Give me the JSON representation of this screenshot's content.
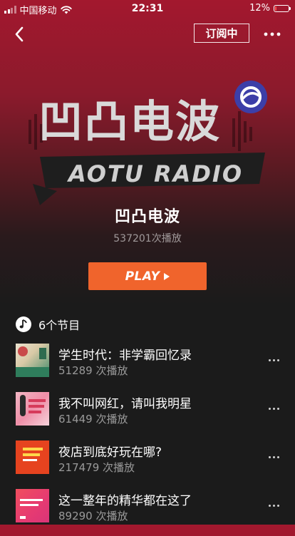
{
  "status_bar": {
    "carrier": "中国移动",
    "time": "22:31",
    "battery_percent": "12%",
    "battery_level": 0.12,
    "battery_color": "#ff4d4d"
  },
  "nav": {
    "back_icon": "chevron-left-icon",
    "subscribe_label": "订阅中",
    "more_icon": "more-horizontal-icon"
  },
  "hero": {
    "logo_cn": "凹凸电波",
    "logo_en": "AOTU RADIO",
    "badge_icon": "earth-icon"
  },
  "program": {
    "title": "凹凸电波",
    "play_count": "537201次播放"
  },
  "play_button": {
    "label": "PLAY",
    "color": "#f0642c"
  },
  "episodes_header": {
    "icon": "music-note-icon",
    "count_label": "6个节目"
  },
  "episodes": [
    {
      "title": "学生时代：非学霸回忆录",
      "plays": "51289 次播放",
      "thumb_text": "学生时代\n非学霸回忆录"
    },
    {
      "title": "我不叫网红，请叫我明星",
      "plays": "61449 次播放",
      "thumb_text": "我不叫网红\n请叫我明星"
    },
    {
      "title": "夜店到底好玩在哪?",
      "plays": "217479 次播放",
      "thumb_text": "夜店到底\n好玩在哪"
    },
    {
      "title": "这一整年的精华都在这了",
      "plays": "89290 次播放",
      "thumb_text": "这一整年的精华\n都在这了"
    }
  ],
  "colors": {
    "accent": "#f0642c",
    "header_red": "#a3182e",
    "background_dark": "#1b1b1b"
  }
}
